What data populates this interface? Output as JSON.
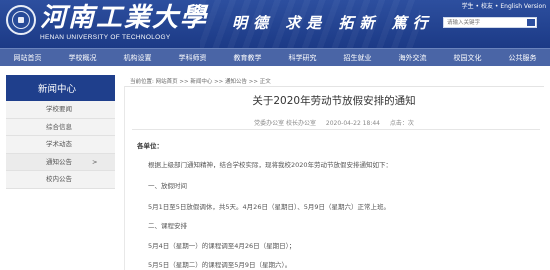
{
  "header": {
    "school_name_cn": "河南工業大學",
    "school_name_en": "HENAN UNIVERSITY OF TECHNOLOGY",
    "motto": "明德 求是 拓新 篤行",
    "top_links": [
      "学生",
      "校友",
      "English Version"
    ],
    "search_placeholder": "请输入关键字"
  },
  "nav": {
    "items": [
      "网站首页",
      "学校概况",
      "机构设置",
      "学科师资",
      "教育教学",
      "科学研究",
      "招生就业",
      "海外交流",
      "校园文化",
      "公共服务"
    ]
  },
  "sidebar": {
    "title": "新闻中心",
    "items": [
      {
        "label": "学校要闻"
      },
      {
        "label": "综合信息"
      },
      {
        "label": "学术动态"
      },
      {
        "label": "通知公告",
        "chevron": ">"
      },
      {
        "label": "校内公告"
      }
    ]
  },
  "breadcrumb": "当前位置: 网站首页 >> 新闻中心 >> 通知公告 >> 正文",
  "article": {
    "title": "关于2020年劳动节放假安排的通知",
    "source": "党委办公室 校长办公室",
    "date": "2020-04-22 18:44",
    "views": "点击：次",
    "greeting": "各单位：",
    "paragraphs": [
      "根据上级部门通知精神，结合学校实际，现将我校2020年劳动节放假安排通知如下：",
      "一、放假时间",
      "5月1日至5日放假调休，共5天。4月26日（星期日）、5月9日（星期六）正常上班。",
      "二、课程安排",
      "5月4日（星期一）的课程调至4月26日（星期日）；",
      "5月5日（星期二）的课程调至5月9日（星期六）。"
    ]
  }
}
